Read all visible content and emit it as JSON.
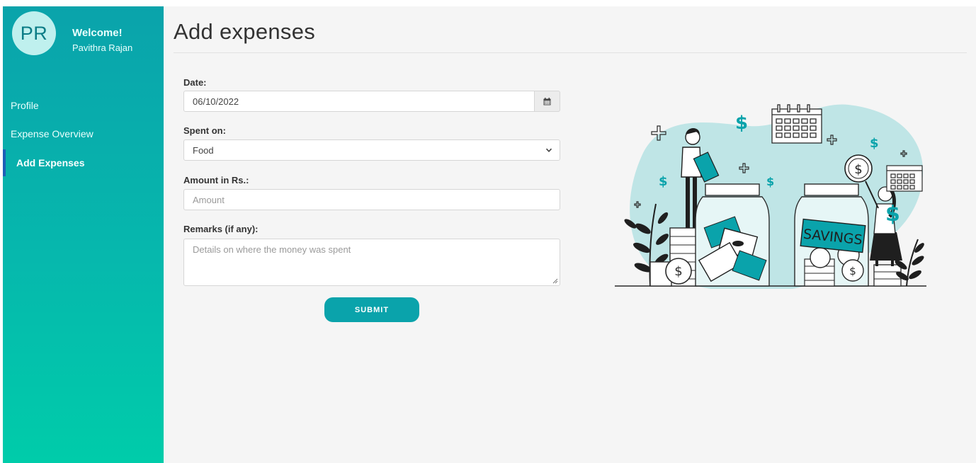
{
  "user": {
    "initials": "PR",
    "welcome": "Welcome!",
    "name": "Pavithra Rajan"
  },
  "sidebar": {
    "items": [
      {
        "label": "Profile",
        "active": false
      },
      {
        "label": "Expense Overview",
        "active": false
      },
      {
        "label": "Add Expenses",
        "active": true
      }
    ]
  },
  "page": {
    "title": "Add expenses"
  },
  "form": {
    "date": {
      "label": "Date:",
      "value": "06/10/2022"
    },
    "spent_on": {
      "label": "Spent on:",
      "value": "Food"
    },
    "amount": {
      "label": "Amount in Rs.:",
      "placeholder": "Amount"
    },
    "remarks": {
      "label": "Remarks (if any):",
      "placeholder": "Details on where the money was spent"
    },
    "submit_label": "SUBMIT"
  },
  "illustration": {
    "jar_label": "SAVINGS",
    "accent_color": "#0aa3ab",
    "blob_color": "#bfe5e6"
  },
  "colors": {
    "sidebar_top": "#0aa3ab",
    "sidebar_bottom": "#00ccaa",
    "active_indicator": "#1d5fb7",
    "button": "#0aa3ab"
  }
}
